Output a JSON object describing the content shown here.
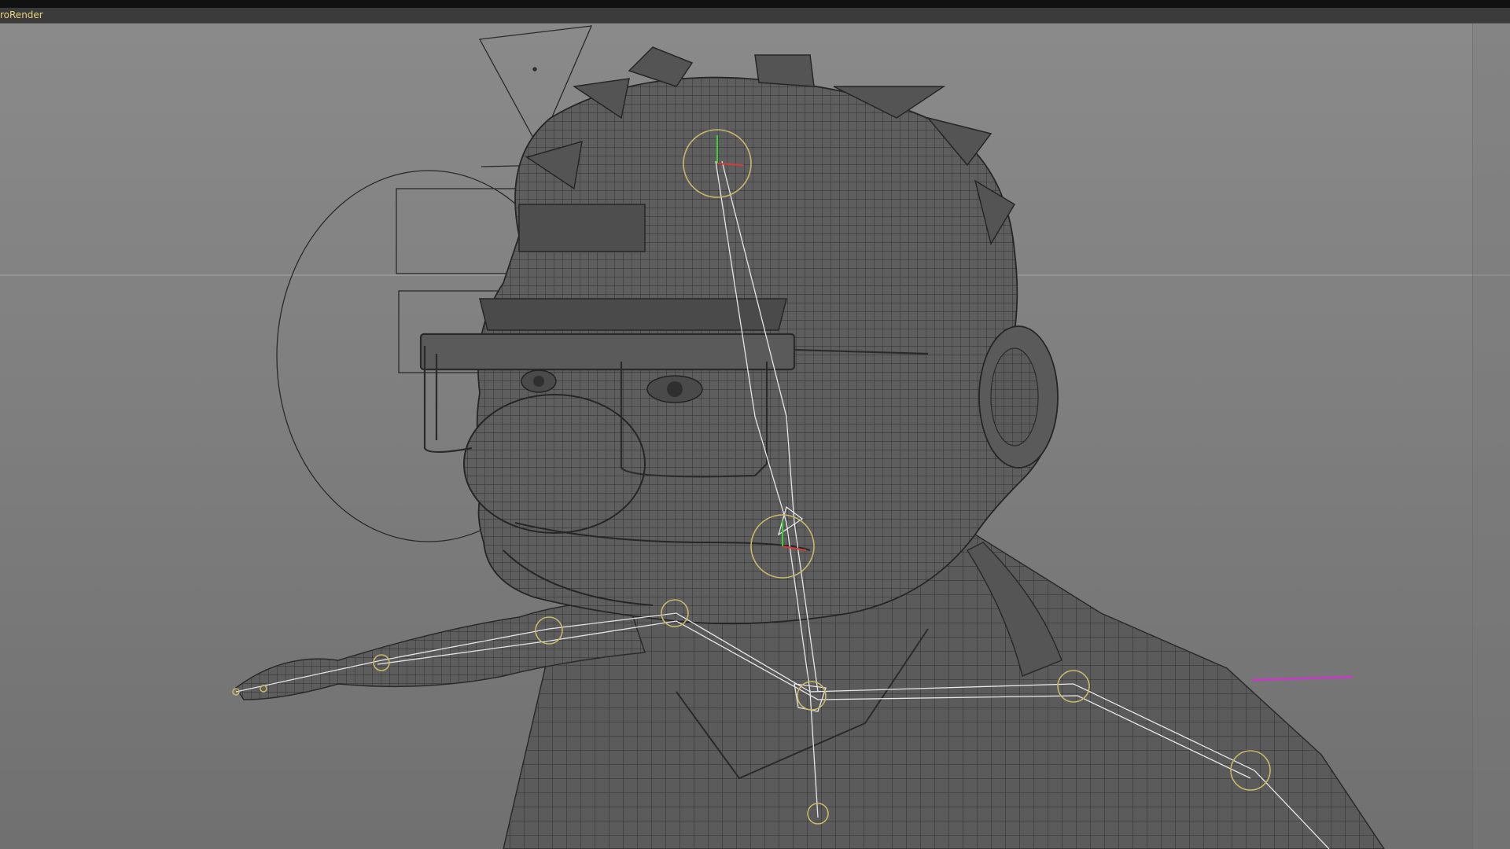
{
  "viewport": {
    "renderer_label": "roRender",
    "shading_mode": "wireframe-on-shaded",
    "colors": {
      "background_top": "#8a8a8a",
      "background_bottom": "#707070",
      "mesh_fill": "#5c5c5c",
      "wire": "#2b2b2b",
      "bone": "#e6e6ea",
      "joint": "#c8b96a",
      "axis_x": "#d33c3c",
      "axis_y": "#3ccf3c",
      "selection": "#c040c0",
      "label": "#e8d27a"
    },
    "icons": [
      "camera-icon",
      "spotlight-icon",
      "area-light-icon"
    ]
  }
}
